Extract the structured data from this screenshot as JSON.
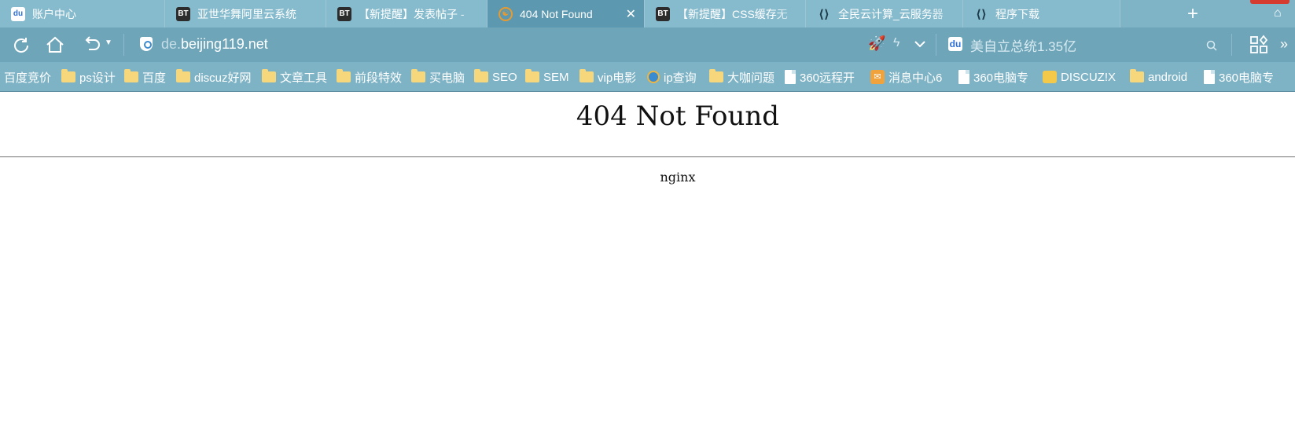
{
  "tabs": [
    {
      "title": "账户中心",
      "icon": "baidu-paw-icon",
      "active": false
    },
    {
      "title": "亚世华舞阿里云系统",
      "icon": "bt-icon",
      "active": false
    },
    {
      "title": "【新提醒】发表帖子 -",
      "icon": "bt-icon",
      "active": false
    },
    {
      "title": "404 Not Found",
      "icon": "nginx-icon",
      "active": true
    },
    {
      "title": "【新提醒】CSS缓存无",
      "icon": "bt-icon",
      "active": false
    },
    {
      "title": "全民云计算_云服务器",
      "icon": "cloud-icon",
      "active": false
    },
    {
      "title": "程序下载",
      "icon": "cloud-icon",
      "active": false
    }
  ],
  "address": {
    "url_prefix": "de.",
    "url_domain": "beijing119.net"
  },
  "search": {
    "text": "美自立总统1.35亿",
    "icon": "baidu-paw-icon"
  },
  "bookmarks": [
    {
      "label": "百度竞价",
      "icon": "none"
    },
    {
      "label": "ps设计",
      "icon": "folder-icon"
    },
    {
      "label": "百度",
      "icon": "folder-icon"
    },
    {
      "label": "discuz好网",
      "icon": "folder-icon"
    },
    {
      "label": "文章工具",
      "icon": "folder-icon"
    },
    {
      "label": "前段特效",
      "icon": "folder-icon"
    },
    {
      "label": "买电脑",
      "icon": "folder-icon"
    },
    {
      "label": "SEO",
      "icon": "folder-icon"
    },
    {
      "label": "SEM",
      "icon": "folder-icon"
    },
    {
      "label": "vip电影",
      "icon": "folder-icon"
    },
    {
      "label": "ip查询",
      "icon": "ie-globe-icon"
    },
    {
      "label": "大咖问题",
      "icon": "folder-icon"
    },
    {
      "label": "360远程开",
      "icon": "document-icon"
    },
    {
      "label": "消息中心6",
      "icon": "message-icon"
    },
    {
      "label": "360电脑专",
      "icon": "document-icon"
    },
    {
      "label": "DISCUZ!X",
      "icon": "discuz-icon"
    },
    {
      "label": "android",
      "icon": "folder-icon"
    },
    {
      "label": "360电脑专",
      "icon": "document-icon"
    }
  ],
  "page": {
    "heading": "404 Not Found",
    "server": "nginx"
  }
}
